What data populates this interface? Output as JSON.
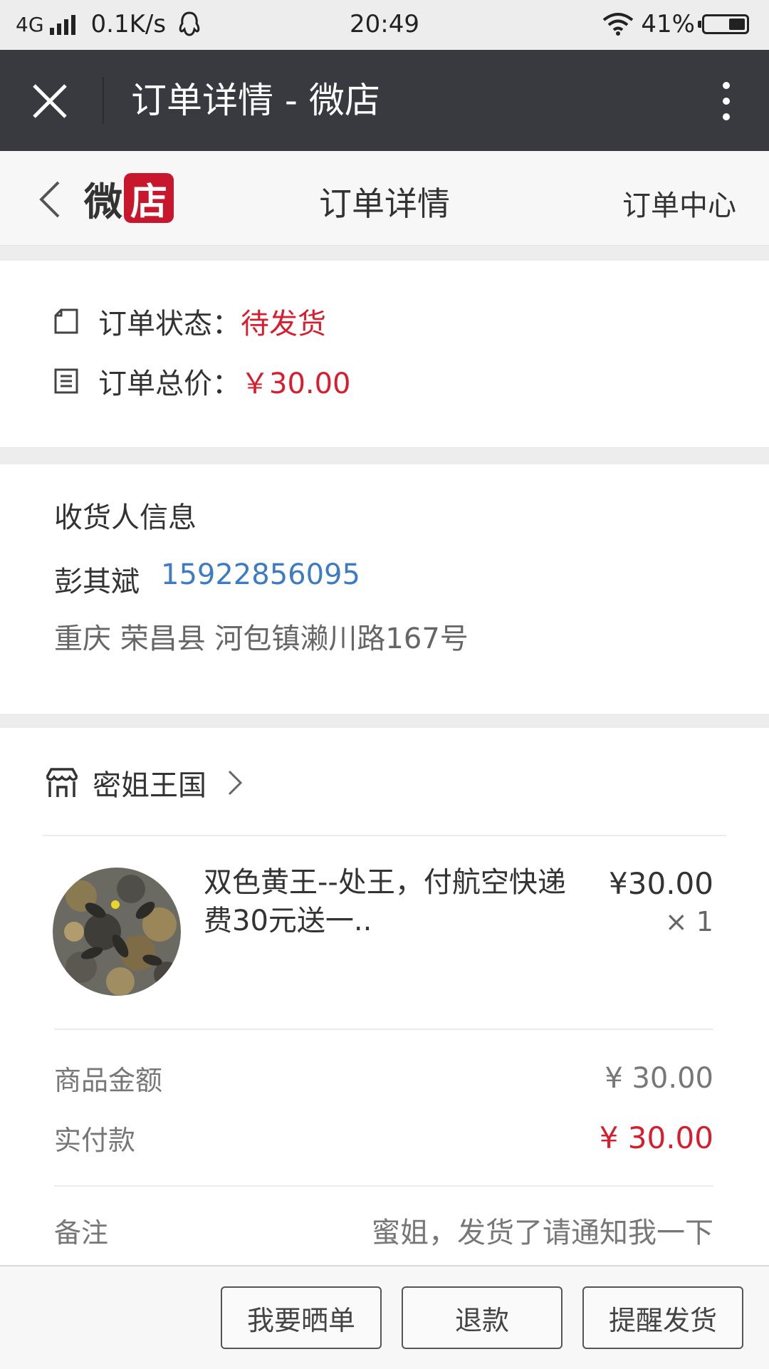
{
  "status_bar": {
    "network": "4G",
    "speed": "0.1K/s",
    "time": "20:49",
    "battery": "41%"
  },
  "title_bar": {
    "title": "订单详情 - 微店"
  },
  "header": {
    "logo_text_1": "微",
    "logo_text_2": "店",
    "title": "订单详情",
    "order_center": "订单中心"
  },
  "order": {
    "status_label": "订单状态：",
    "status_value": "待发货",
    "total_label": "订单总价：",
    "total_value": "￥30.00"
  },
  "receiver": {
    "section_label": "收货人信息",
    "name": "彭其斌",
    "phone": "15922856095",
    "address": "重庆 荣昌县 河包镇濑川路167号"
  },
  "goods": {
    "shop_name": "密姐王国",
    "item_name": "双色黄王--处王，付航空快递费30元送一..",
    "item_price": "¥30.00",
    "item_qty": "× 1",
    "subtotal_label": "商品金额",
    "subtotal_value": "¥ 30.00",
    "paid_label": "实付款",
    "paid_value": "¥ 30.00",
    "note_label": "备注",
    "note_value": "蜜姐，发货了请通知我一下"
  },
  "actions": {
    "review_button": "我要晒单",
    "refund_button": "退款",
    "remind_button": "提醒发货"
  },
  "colors": {
    "accent_red": "#d81e2e",
    "link_blue": "#3d7bc3",
    "title_bar_bg": "#383a40"
  },
  "icons": [
    "close-icon",
    "more-icon",
    "back-icon",
    "order-status-icon",
    "order-total-icon",
    "store-icon",
    "chevron-right-icon"
  ]
}
